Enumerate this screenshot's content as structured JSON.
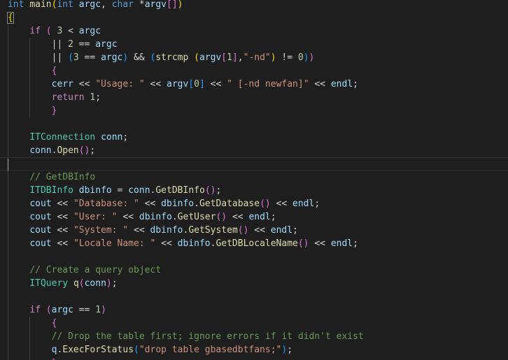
{
  "editor": {
    "language": "cpp",
    "theme": {
      "background": "#1e1e1e",
      "keyword": "#569cd6",
      "control": "#c586c0",
      "function": "#dcdcaa",
      "type": "#4ec9b0",
      "variable": "#9cdcfe",
      "string": "#ce9178",
      "number": "#b5cea8",
      "comment": "#6a9955",
      "bracket_level_1": "#ffd700",
      "bracket_level_2": "#da70d6",
      "bracket_level_3": "#179fff"
    },
    "current_line": 12,
    "lines": [
      [
        [
          "kw",
          "int"
        ],
        [
          "op",
          " "
        ],
        [
          "fn",
          "main"
        ],
        [
          "b1",
          "("
        ],
        [
          "kw",
          "int"
        ],
        [
          "op",
          " "
        ],
        [
          "var",
          "argc"
        ],
        [
          "op",
          ", "
        ],
        [
          "kw",
          "char"
        ],
        [
          "op",
          " *"
        ],
        [
          "var",
          "argv"
        ],
        [
          "b2",
          "[]"
        ],
        [
          "b1",
          ")"
        ]
      ],
      [
        [
          "b1m",
          "{"
        ]
      ],
      [
        [
          "op",
          "    "
        ],
        [
          "ctl",
          "if"
        ],
        [
          "op",
          " "
        ],
        [
          "b2",
          "("
        ],
        [
          "op",
          " "
        ],
        [
          "num",
          "3"
        ],
        [
          "op",
          " < "
        ],
        [
          "var",
          "argc"
        ]
      ],
      [
        [
          "op",
          "        || "
        ],
        [
          "num",
          "2"
        ],
        [
          "op",
          " == "
        ],
        [
          "var",
          "argc"
        ]
      ],
      [
        [
          "op",
          "        || "
        ],
        [
          "b3",
          "("
        ],
        [
          "num",
          "3"
        ],
        [
          "op",
          " == "
        ],
        [
          "var",
          "argc"
        ],
        [
          "b3",
          ")"
        ],
        [
          "op",
          " && "
        ],
        [
          "b3",
          "("
        ],
        [
          "fn",
          "strcmp"
        ],
        [
          "op",
          " "
        ],
        [
          "b1",
          "("
        ],
        [
          "var",
          "argv"
        ],
        [
          "b2",
          "["
        ],
        [
          "num",
          "1"
        ],
        [
          "b2",
          "]"
        ],
        [
          "op",
          ","
        ],
        [
          "str",
          "\"-nd\""
        ],
        [
          "b1",
          ")"
        ],
        [
          "op",
          " != "
        ],
        [
          "num",
          "0"
        ],
        [
          "b3",
          ")"
        ],
        [
          "b2",
          ")"
        ]
      ],
      [
        [
          "op",
          "        "
        ],
        [
          "b2",
          "{"
        ]
      ],
      [
        [
          "op",
          "        "
        ],
        [
          "var",
          "cerr"
        ],
        [
          "op",
          " << "
        ],
        [
          "str",
          "\"Usage: \""
        ],
        [
          "op",
          " << "
        ],
        [
          "var",
          "argv"
        ],
        [
          "b3",
          "["
        ],
        [
          "num",
          "0"
        ],
        [
          "b3",
          "]"
        ],
        [
          "op",
          " << "
        ],
        [
          "str",
          "\" [-nd newfan]\""
        ],
        [
          "op",
          " << "
        ],
        [
          "var",
          "endl"
        ],
        [
          "op",
          ";"
        ]
      ],
      [
        [
          "op",
          "        "
        ],
        [
          "ctl",
          "return"
        ],
        [
          "op",
          " "
        ],
        [
          "num",
          "1"
        ],
        [
          "op",
          ";"
        ]
      ],
      [
        [
          "op",
          "        "
        ],
        [
          "b2",
          "}"
        ]
      ],
      [],
      [
        [
          "op",
          "    "
        ],
        [
          "type",
          "ITConnection"
        ],
        [
          "op",
          " "
        ],
        [
          "var",
          "conn"
        ],
        [
          "op",
          ";"
        ]
      ],
      [
        [
          "op",
          "    "
        ],
        [
          "var",
          "conn"
        ],
        [
          "op",
          "."
        ],
        [
          "fn",
          "Open"
        ],
        [
          "b2",
          "()"
        ],
        [
          "op",
          ";"
        ]
      ],
      [],
      [
        [
          "op",
          "    "
        ],
        [
          "cmt",
          "// GetDBInfo"
        ]
      ],
      [
        [
          "op",
          "    "
        ],
        [
          "type",
          "ITDBInfo"
        ],
        [
          "op",
          " "
        ],
        [
          "var",
          "dbinfo"
        ],
        [
          "op",
          " = "
        ],
        [
          "var",
          "conn"
        ],
        [
          "op",
          "."
        ],
        [
          "fn",
          "GetDBInfo"
        ],
        [
          "b2",
          "()"
        ],
        [
          "op",
          ";"
        ]
      ],
      [
        [
          "op",
          "    "
        ],
        [
          "var",
          "cout"
        ],
        [
          "op",
          " << "
        ],
        [
          "str",
          "\"Database: \""
        ],
        [
          "op",
          " << "
        ],
        [
          "var",
          "dbinfo"
        ],
        [
          "op",
          "."
        ],
        [
          "fn",
          "GetDatabase"
        ],
        [
          "b2",
          "()"
        ],
        [
          "op",
          " << "
        ],
        [
          "var",
          "endl"
        ],
        [
          "op",
          ";"
        ]
      ],
      [
        [
          "op",
          "    "
        ],
        [
          "var",
          "cout"
        ],
        [
          "op",
          " << "
        ],
        [
          "str",
          "\"User: \""
        ],
        [
          "op",
          " << "
        ],
        [
          "var",
          "dbinfo"
        ],
        [
          "op",
          "."
        ],
        [
          "fn",
          "GetUser"
        ],
        [
          "b2",
          "()"
        ],
        [
          "op",
          " << "
        ],
        [
          "var",
          "endl"
        ],
        [
          "op",
          ";"
        ]
      ],
      [
        [
          "op",
          "    "
        ],
        [
          "var",
          "cout"
        ],
        [
          "op",
          " << "
        ],
        [
          "str",
          "\"System: \""
        ],
        [
          "op",
          " << "
        ],
        [
          "var",
          "dbinfo"
        ],
        [
          "op",
          "."
        ],
        [
          "fn",
          "GetSystem"
        ],
        [
          "b2",
          "()"
        ],
        [
          "op",
          " << "
        ],
        [
          "var",
          "endl"
        ],
        [
          "op",
          ";"
        ]
      ],
      [
        [
          "op",
          "    "
        ],
        [
          "var",
          "cout"
        ],
        [
          "op",
          " << "
        ],
        [
          "str",
          "\"Locale Name: \""
        ],
        [
          "op",
          " << "
        ],
        [
          "var",
          "dbinfo"
        ],
        [
          "op",
          "."
        ],
        [
          "fn",
          "GetDBLocaleName"
        ],
        [
          "b2",
          "()"
        ],
        [
          "op",
          " << "
        ],
        [
          "var",
          "endl"
        ],
        [
          "op",
          ";"
        ]
      ],
      [],
      [
        [
          "op",
          "    "
        ],
        [
          "cmt",
          "// Create a query object"
        ]
      ],
      [
        [
          "op",
          "    "
        ],
        [
          "type",
          "ITQuery"
        ],
        [
          "op",
          " "
        ],
        [
          "fn",
          "q"
        ],
        [
          "b2",
          "("
        ],
        [
          "var",
          "conn"
        ],
        [
          "b2",
          ")"
        ],
        [
          "op",
          ";"
        ]
      ],
      [],
      [
        [
          "op",
          "    "
        ],
        [
          "ctl",
          "if"
        ],
        [
          "op",
          " "
        ],
        [
          "b2",
          "("
        ],
        [
          "var",
          "argc"
        ],
        [
          "op",
          " == "
        ],
        [
          "num",
          "1"
        ],
        [
          "b2",
          ")"
        ]
      ],
      [
        [
          "op",
          "        "
        ],
        [
          "b2",
          "{"
        ]
      ],
      [
        [
          "op",
          "        "
        ],
        [
          "cmt",
          "// Drop the table first; ignore errors if it didn't exist"
        ]
      ],
      [
        [
          "op",
          "        "
        ],
        [
          "var",
          "q"
        ],
        [
          "op",
          "."
        ],
        [
          "fn",
          "ExecForStatus"
        ],
        [
          "b3",
          "("
        ],
        [
          "str",
          "\"drop table gbasedbtfans;\""
        ],
        [
          "b3",
          ")"
        ],
        [
          "op",
          ";"
        ]
      ],
      [
        [
          "op",
          "        "
        ],
        [
          "b2",
          "}"
        ]
      ]
    ]
  }
}
